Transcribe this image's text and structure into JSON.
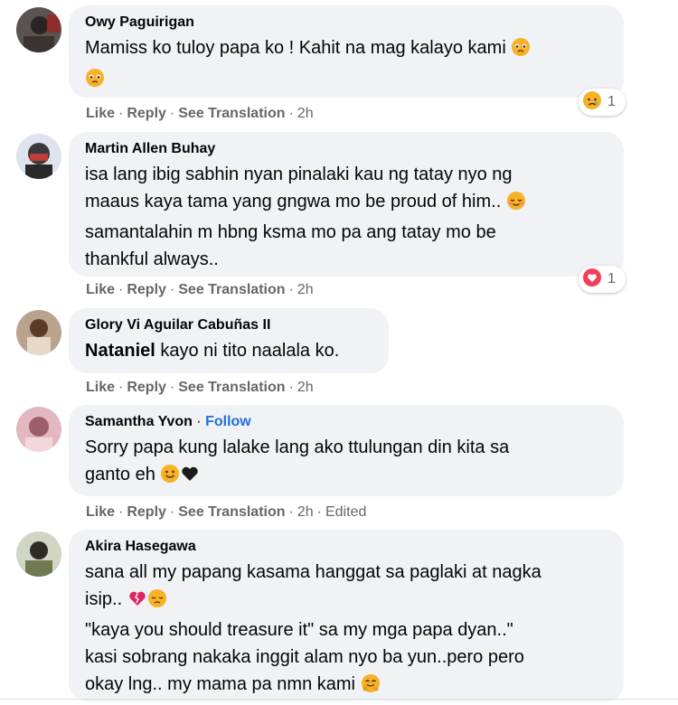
{
  "comments": [
    {
      "author": "Owy Paguirigan",
      "text_line1": "Mamiss ko tuloy papa ko ! Kahit na mag kalayo kami",
      "like": "Like",
      "reply": "Reply",
      "translate": "See Translation",
      "time": "2h",
      "reaction_count": "1",
      "reaction_icon": "sad-face-icon"
    },
    {
      "author": "Martin Allen Buhay",
      "line1": "isa lang ibig sabhin nyan pinalaki kau ng tatay nyo ng",
      "line2": "maaus kaya tama yang gngwa mo be proud of him..",
      "line3": "samantalahin m hbng ksma mo pa ang tatay mo be",
      "line4": "thankful always..",
      "like": "Like",
      "reply": "Reply",
      "translate": "See Translation",
      "time": "2h",
      "reaction_count": "1",
      "reaction_icon": "heart-icon"
    },
    {
      "author": "Glory Vi Aguilar Cabuñas II",
      "mention": "Nataniel",
      "text": " kayo ni tito naalala ko.",
      "like": "Like",
      "reply": "Reply",
      "translate": "See Translation",
      "time": "2h"
    },
    {
      "author": "Samantha Yvon",
      "follow": "Follow",
      "line1": "Sorry papa kung lalake lang ako ttulungan din kita sa",
      "line2": "ganto eh",
      "like": "Like",
      "reply": "Reply",
      "translate": "See Translation",
      "time": "2h",
      "edited": "Edited"
    },
    {
      "author": "Akira Hasegawa",
      "line1": "sana all my papang kasama hanggat sa paglaki at nagka",
      "line2": "isip..",
      "line3": "\"kaya you should treasure it\" sa my mga papa dyan..\"",
      "line4": "kasi sobrang nakaka inggit alam nyo ba yun..pero pero",
      "line5": "okay lng.. my mama pa nmn kami"
    }
  ],
  "colors": {
    "bubble": "#f0f2f5",
    "meta": "#65676b",
    "follow": "#216fdb",
    "heart": "#f33e58",
    "emoji": "#f7b125"
  }
}
